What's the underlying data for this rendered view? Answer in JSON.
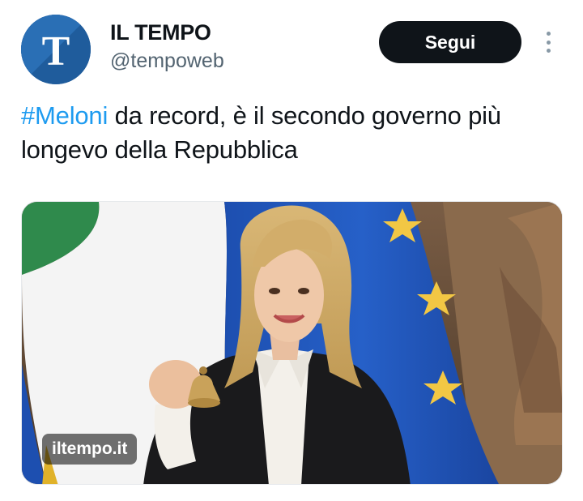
{
  "author": {
    "display_name": "IL TEMPO",
    "handle": "@tempoweb",
    "avatar_letter": "T",
    "avatar_color": "#1f5c9c"
  },
  "actions": {
    "follow_label": "Segui",
    "more_icon": "vertical-dots-icon"
  },
  "tweet": {
    "hashtag": "#Meloni",
    "text": " da record, è il secondo governo più longevo della Repubblica"
  },
  "card": {
    "domain": "iltempo.it"
  },
  "colors": {
    "accent": "#1d9bf0",
    "text": "#0f1419",
    "secondary_text": "#536471",
    "button_bg": "#0f1419"
  }
}
